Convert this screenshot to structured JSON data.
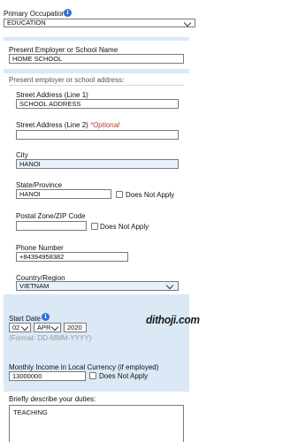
{
  "primary_occupation": {
    "label": "Primary Occupation",
    "value": "EDUCATION"
  },
  "employer": {
    "label": "Present Employer or School Name",
    "value": "HOME SCHOOL"
  },
  "address_section": {
    "heading": "Present employer or school address:",
    "street1_label": "Street Address (Line 1)",
    "street1_value": "SCHOOL ADDRESS",
    "street2_label": "Street Address (Line 2)",
    "street2_optional": "*Optional",
    "street2_value": "",
    "city_label": "City",
    "city_value": "HANOI",
    "state_label": "State/Province",
    "state_value": "HANOI",
    "state_dna": "Does Not Apply",
    "postal_label": "Postal Zone/ZIP Code",
    "postal_value": "",
    "postal_dna": "Does Not Apply",
    "phone_label": "Phone Number",
    "phone_value": "+84394958382",
    "country_label": "Country/Region",
    "country_value": "VIETNAM"
  },
  "start_date": {
    "label": "Start Date",
    "day": "02",
    "month": "APR",
    "year": "2020",
    "format": "(Format: DD-MMM-YYYY)"
  },
  "watermark": "dithoji.com",
  "income": {
    "label": "Monthly Income in Local Currency (if employed)",
    "value": "13000000",
    "dna": "Does Not Apply"
  },
  "duties": {
    "label": "Briefly describe your duties:",
    "value": "TEACHING"
  },
  "colors": {
    "panel": "#dbe8f6",
    "info": "#2f6fd6",
    "optional": "#c0392b",
    "autofill": "#e8f0fe"
  }
}
